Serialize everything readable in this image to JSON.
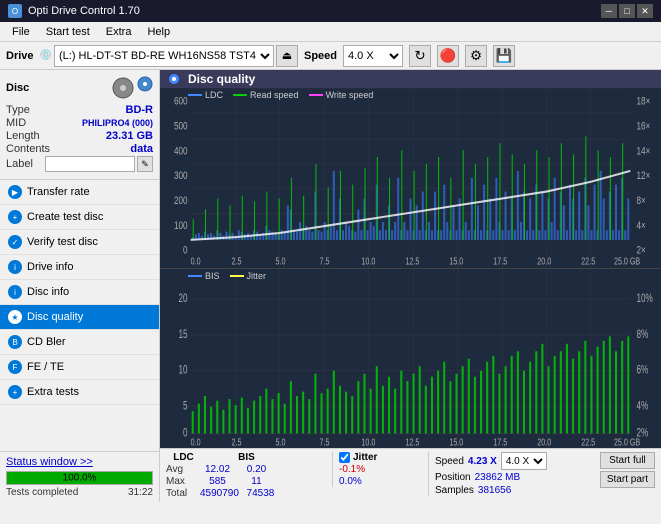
{
  "titlebar": {
    "title": "Opti Drive Control 1.70",
    "icon": "O",
    "minimize": "─",
    "maximize": "□",
    "close": "✕"
  },
  "menubar": {
    "items": [
      "File",
      "Start test",
      "Extra",
      "Help"
    ]
  },
  "toolbar": {
    "drive_label": "Drive",
    "drive_value": "(L:)  HL-DT-ST BD-RE  WH16NS58 TST4",
    "speed_label": "Speed",
    "speed_value": "4.0 X"
  },
  "disc": {
    "section_label": "Disc",
    "rows": [
      {
        "label": "Type",
        "value": "BD-R"
      },
      {
        "label": "MID",
        "value": "PHILIPRO4 (000)"
      },
      {
        "label": "Length",
        "value": "23.31 GB"
      },
      {
        "label": "Contents",
        "value": "data"
      },
      {
        "label": "Label",
        "value": ""
      }
    ]
  },
  "nav": {
    "items": [
      {
        "id": "transfer-rate",
        "label": "Transfer rate",
        "active": false
      },
      {
        "id": "create-test-disc",
        "label": "Create test disc",
        "active": false
      },
      {
        "id": "verify-test-disc",
        "label": "Verify test disc",
        "active": false
      },
      {
        "id": "drive-info",
        "label": "Drive info",
        "active": false
      },
      {
        "id": "disc-info",
        "label": "Disc info",
        "active": false
      },
      {
        "id": "disc-quality",
        "label": "Disc quality",
        "active": true
      },
      {
        "id": "cd-bler",
        "label": "CD Bler",
        "active": false
      },
      {
        "id": "fe-te",
        "label": "FE / TE",
        "active": false
      },
      {
        "id": "extra-tests",
        "label": "Extra tests",
        "active": false
      }
    ]
  },
  "status": {
    "link_label": "Status window >>",
    "text": "Tests completed",
    "progress": 100,
    "progress_label": "100.0%",
    "time": "31:22"
  },
  "chart": {
    "title": "Disc quality",
    "legend_top": [
      {
        "label": "LDC",
        "color": "#4488ff"
      },
      {
        "label": "Read speed",
        "color": "#00cc00"
      },
      {
        "label": "Write speed",
        "color": "#ff44ff"
      }
    ],
    "legend_bottom": [
      {
        "label": "BIS",
        "color": "#4488ff"
      },
      {
        "label": "Jitter",
        "color": "#ffff44"
      }
    ],
    "top_yaxis": [
      "18×",
      "16×",
      "14×",
      "12×",
      "10×",
      "8×",
      "6×",
      "4×",
      "2×"
    ],
    "top_yaxis_left": [
      "600",
      "500",
      "400",
      "300",
      "200",
      "100",
      "0"
    ],
    "bottom_yaxis_left": [
      "20",
      "15",
      "10",
      "5",
      "0"
    ],
    "bottom_yaxis_right": [
      "10%",
      "8%",
      "6%",
      "4%",
      "2%"
    ],
    "xaxis": [
      "0.0",
      "2.5",
      "5.0",
      "7.5",
      "10.0",
      "12.5",
      "15.0",
      "17.5",
      "20.0",
      "22.5",
      "25.0 GB"
    ]
  },
  "stats": {
    "col_headers": [
      "LDC",
      "BIS",
      "",
      "Jitter",
      "Speed",
      ""
    ],
    "avg_label": "Avg",
    "max_label": "Max",
    "total_label": "Total",
    "ldc_avg": "12.02",
    "ldc_max": "585",
    "ldc_total": "4590790",
    "bis_avg": "0.20",
    "bis_max": "11",
    "bis_total": "74538",
    "jitter_avg": "-0.1%",
    "jitter_max": "0.0%",
    "jitter_total": "",
    "speed_label": "Speed",
    "speed_val": "4.23 X",
    "speed_select": "4.0 X",
    "position_label": "Position",
    "position_val": "23862 MB",
    "samples_label": "Samples",
    "samples_val": "381656",
    "start_full": "Start full",
    "start_part": "Start part",
    "jitter_checkbox": true,
    "jitter_check_label": "Jitter"
  }
}
